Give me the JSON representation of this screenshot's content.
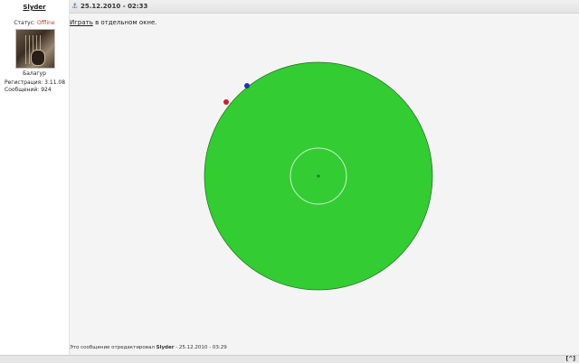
{
  "user": {
    "name": "Slyder",
    "status_label": "Статус:",
    "status_value": "Offline",
    "rank": "Балагур",
    "registration": "Регистрация: 3.11.08",
    "messages": "Сообщений: 924"
  },
  "post": {
    "date": "25.12.2010 - 02:33",
    "play_link": "Играть",
    "play_suffix": " в отдельном окне.",
    "edit_prefix": "Это сообщение отредактировал ",
    "edit_user": "Slyder",
    "edit_suffix": " - 25.12.2010 - 03:29"
  },
  "footer": {
    "top_label": "[^]"
  },
  "colors": {
    "field": "#33cc33",
    "ball_red": "#cc2222",
    "ball_blue": "#2233aa",
    "status_offline": "#c0392b"
  },
  "icons": {
    "post_icon": "anchor-icon"
  }
}
